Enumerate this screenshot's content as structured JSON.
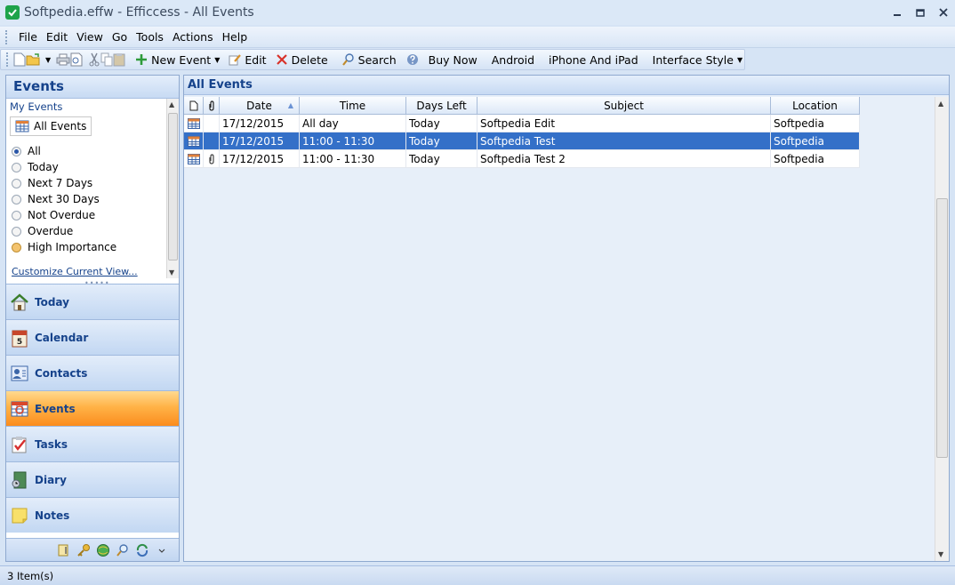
{
  "window": {
    "title": "Softpedia.effw - Efficcess - All Events",
    "minimize_icon": "minimize-icon",
    "restore_icon": "restore-icon",
    "close_icon": "close-icon"
  },
  "menu": {
    "items": [
      "File",
      "Edit",
      "View",
      "Go",
      "Tools",
      "Actions",
      "Help"
    ]
  },
  "toolbar": {
    "new_event": "New Event",
    "edit": "Edit",
    "delete": "Delete",
    "search": "Search",
    "buy_now": "Buy Now",
    "android": "Android",
    "iphone": "iPhone And iPad",
    "interface_style": "Interface Style"
  },
  "left_panel": {
    "title": "Events",
    "section": "My Events",
    "current_view": "All Events",
    "filters": [
      {
        "label": "All",
        "checked": true
      },
      {
        "label": "Today",
        "checked": false
      },
      {
        "label": "Next 7 Days",
        "checked": false
      },
      {
        "label": "Next 30 Days",
        "checked": false
      },
      {
        "label": "Not Overdue",
        "checked": false
      },
      {
        "label": "Overdue",
        "checked": false
      },
      {
        "label": "High Importance",
        "checked": false
      }
    ],
    "customize_link": "Customize Current View...",
    "nav": [
      {
        "label": "Today",
        "icon": "home-icon",
        "active": false
      },
      {
        "label": "Calendar",
        "icon": "calendar-icon",
        "active": false
      },
      {
        "label": "Contacts",
        "icon": "contacts-icon",
        "active": false
      },
      {
        "label": "Events",
        "icon": "events-icon",
        "active": true
      },
      {
        "label": "Tasks",
        "icon": "tasks-icon",
        "active": false
      },
      {
        "label": "Diary",
        "icon": "diary-icon",
        "active": false
      },
      {
        "label": "Notes",
        "icon": "notes-icon",
        "active": false
      }
    ]
  },
  "main": {
    "title": "All Events",
    "columns": [
      "",
      "",
      "Date",
      "Time",
      "Days Left",
      "Subject",
      "Location"
    ],
    "rows": [
      {
        "date": "17/12/2015",
        "time": "All day",
        "days_left": "Today",
        "subject": "Softpedia Edit",
        "location": "Softpedia",
        "attachment": false,
        "selected": false
      },
      {
        "date": "17/12/2015",
        "time": "11:00 - 11:30",
        "days_left": "Today",
        "subject": "Softpedia Test",
        "location": "Softpedia",
        "attachment": false,
        "selected": true
      },
      {
        "date": "17/12/2015",
        "time": "11:00 - 11:30",
        "days_left": "Today",
        "subject": "Softpedia Test 2",
        "location": "Softpedia",
        "attachment": true,
        "selected": false
      }
    ]
  },
  "status": {
    "text": "3 Item(s)"
  },
  "colors": {
    "selection": "#3470c8",
    "active_nav": "#fb8c1d",
    "header_text": "#15428b"
  }
}
